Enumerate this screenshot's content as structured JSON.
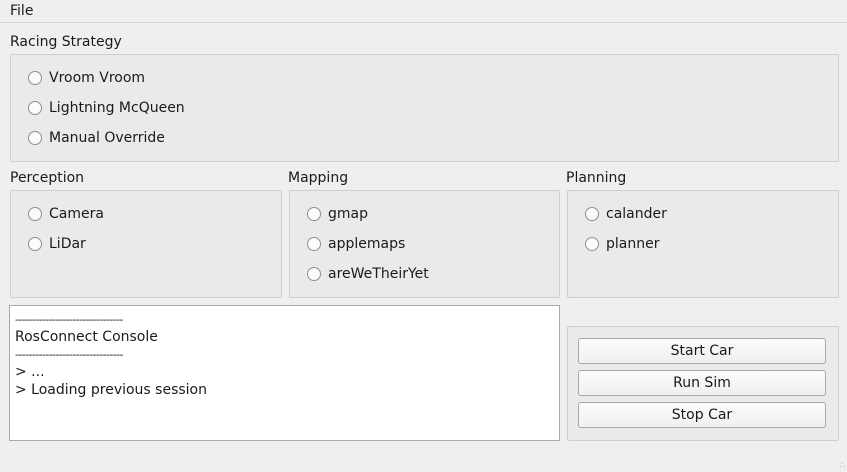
{
  "menubar": {
    "file": "File"
  },
  "racing_strategy": {
    "title": "Racing Strategy",
    "options": [
      "Vroom Vroom",
      "Lightning McQueen",
      "Manual Override"
    ]
  },
  "perception": {
    "title": "Perception",
    "options": [
      "Camera",
      "LiDar"
    ]
  },
  "mapping": {
    "title": "Mapping",
    "options": [
      "gmap",
      "applemaps",
      "areWeTheirYet"
    ]
  },
  "planning": {
    "title": "Planning",
    "options": [
      "calander",
      "planner"
    ]
  },
  "console": {
    "lines": [
      "--------------------------------",
      "RosConnect Console",
      "--------------------------------",
      "> ...",
      "> Loading previous session"
    ]
  },
  "buttons": {
    "start": "Start Car",
    "run_sim": "Run Sim",
    "stop": "Stop Car"
  }
}
